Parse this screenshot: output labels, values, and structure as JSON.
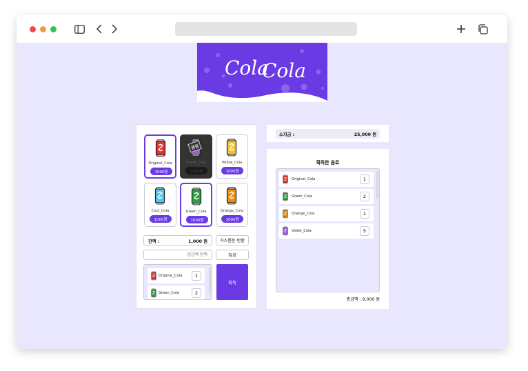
{
  "browser": {
    "icons": [
      "sidebar-icon",
      "back-icon",
      "forward-icon",
      "new-tab-icon",
      "tabs-overview-icon"
    ]
  },
  "logo": {
    "text_1": "Cola",
    "text_2": "Cola"
  },
  "machine": {
    "items": [
      {
        "name": "Original_Cola",
        "price": "1000원",
        "color": "#e03131",
        "state": "selected"
      },
      {
        "name": "Violet_Cola",
        "price": "1000원",
        "color": "#9b5de5",
        "state": "soldout",
        "soldout_label": "품절"
      },
      {
        "name": "Yellow_Cola",
        "price": "1000원",
        "color": "#f4c430",
        "state": "normal"
      },
      {
        "name": "Cool_Cola",
        "price": "1000원",
        "color": "#4cc9f0",
        "state": "normal"
      },
      {
        "name": "Green_Cola",
        "price": "1000원",
        "color": "#2f9e44",
        "state": "selected"
      },
      {
        "name": "Orange_Cola",
        "price": "1000원",
        "color": "#f08c00",
        "state": "normal"
      }
    ],
    "balance_label": "잔액 :",
    "balance_value": "1,000 원",
    "change_button": "거스름돈 반환",
    "deposit_placeholder": "입금액 입력",
    "deposit_button": "입금",
    "get_button": "획득",
    "cart": [
      {
        "name": "Original_Cola",
        "qty": "1",
        "color": "#e03131"
      },
      {
        "name": "Green_Cola",
        "qty": "2",
        "color": "#2f9e44"
      }
    ]
  },
  "wallet": {
    "label": "소지금 :",
    "value": "25,000 원"
  },
  "acquired": {
    "title": "획득한 음료",
    "items": [
      {
        "name": "Original_Cola",
        "qty": "1",
        "color": "#e03131"
      },
      {
        "name": "Green_Cola",
        "qty": "2",
        "color": "#2f9e44"
      },
      {
        "name": "Orange_Cola",
        "qty": "1",
        "color": "#f08c00"
      },
      {
        "name": "Violet_Cola",
        "qty": "5",
        "color": "#9b5de5"
      }
    ],
    "total": "총금액 : 9,000 원"
  },
  "colors": {
    "accent": "#6a3be4",
    "background": "#e9e7fd"
  }
}
